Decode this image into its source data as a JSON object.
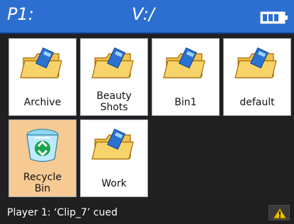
{
  "header": {
    "player_label": "P1:",
    "path_label": "V:/"
  },
  "tiles": [
    {
      "label": "Archive",
      "icon": "folder-icon"
    },
    {
      "label": "Beauty\nShots",
      "icon": "folder-icon"
    },
    {
      "label": "Bin1",
      "icon": "folder-icon"
    },
    {
      "label": "default",
      "icon": "folder-icon"
    },
    {
      "label": "Recycle\nBin",
      "icon": "recycle-bin-icon"
    },
    {
      "label": "Work",
      "icon": "folder-icon"
    }
  ],
  "status": {
    "text": "Player 1: ‘Clip_7’ cued",
    "warning_icon": "warning-icon"
  },
  "colors": {
    "header": "#2c6fd0",
    "tile_bg": "#ffffff",
    "selected_bg": "#f7c993",
    "status_bg": "#1f1f1f"
  }
}
